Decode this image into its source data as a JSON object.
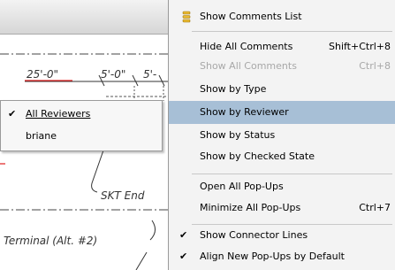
{
  "drawing": {
    "dimensions": [
      "25'-0\"",
      "5'-0\"",
      "5'-"
    ],
    "note_skt_end": "SKT End",
    "note_terminal": "Terminal (Alt. #2)"
  },
  "reviewer_submenu": {
    "items": [
      {
        "label": "All Reviewers",
        "checked": true,
        "check": "✔"
      },
      {
        "label": "briane",
        "checked": false,
        "check": ""
      }
    ]
  },
  "context_menu": {
    "show_comments_list": "Show Comments List",
    "hide_all_comments": {
      "label": "Hide All Comments",
      "shortcut": "Shift+Ctrl+8"
    },
    "show_all_comments": {
      "label": "Show All Comments",
      "shortcut": "Ctrl+8",
      "disabled": true
    },
    "show_by_type": "Show by Type",
    "show_by_reviewer": "Show by Reviewer",
    "show_by_status": "Show by Status",
    "show_by_checked_state": "Show by Checked State",
    "open_all_popups": "Open All Pop-Ups",
    "minimize_all_popups": {
      "label": "Minimize All Pop-Ups",
      "shortcut": "Ctrl+7"
    },
    "show_connector_lines": {
      "label": "Show Connector Lines",
      "checked": true,
      "check": "✔"
    },
    "align_new_popups": {
      "label": "Align New Pop-Ups by Default",
      "checked": true,
      "check": "✔"
    },
    "highlight_color": "#a7bfd6",
    "icon": "comments-list-icon"
  }
}
